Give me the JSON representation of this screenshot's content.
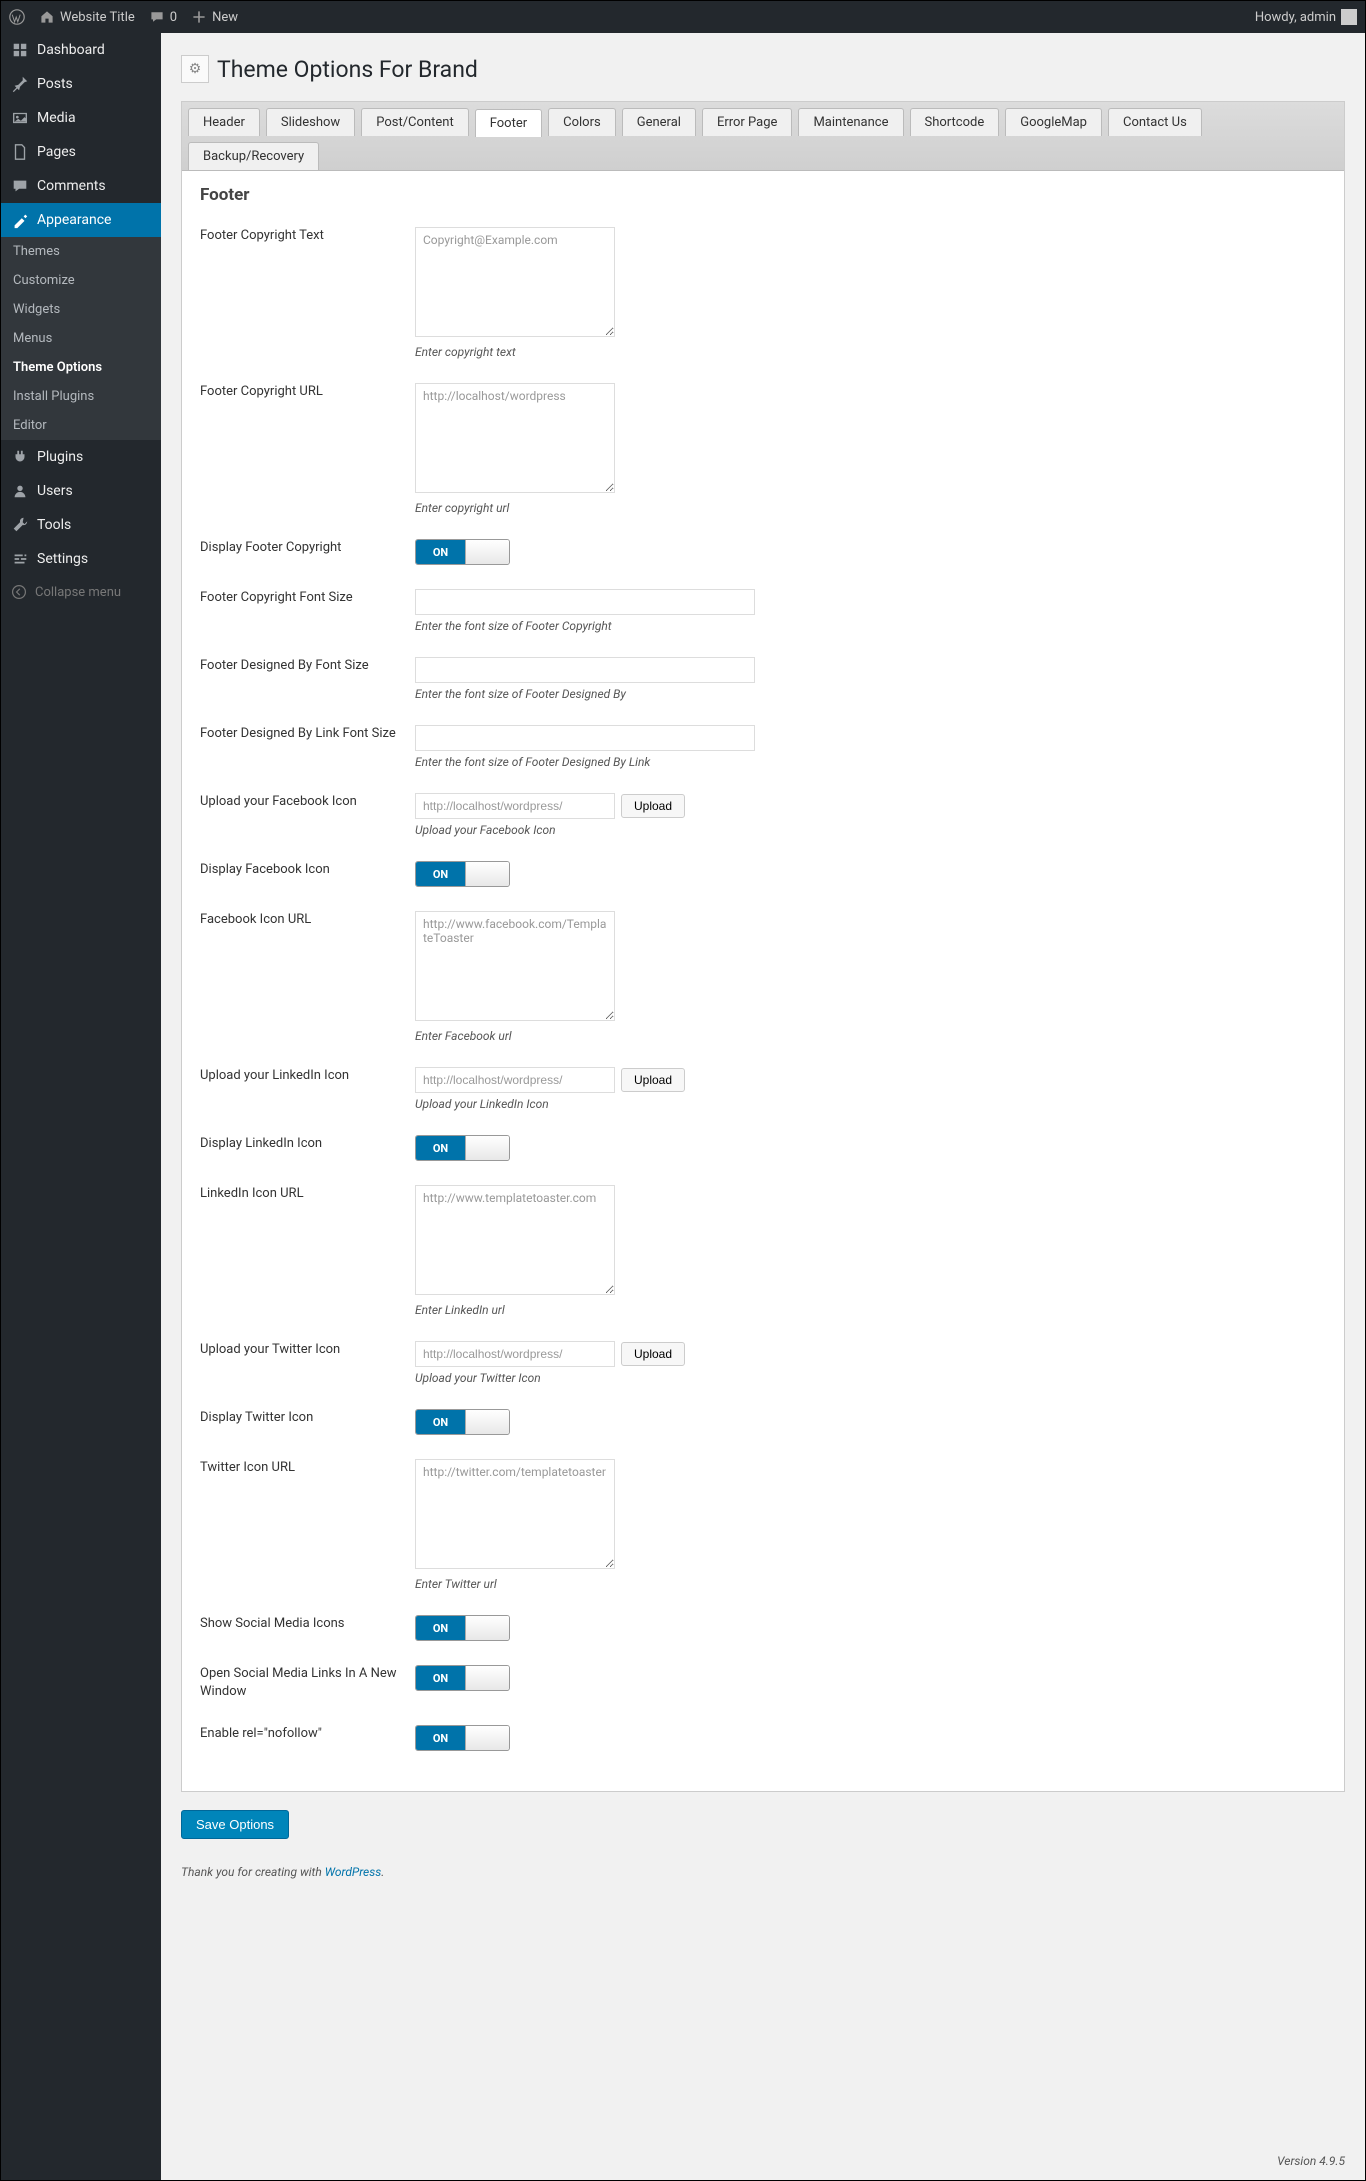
{
  "adminbar": {
    "site_title": "Website Title",
    "comment_count": "0",
    "new_label": "New",
    "howdy": "Howdy, admin"
  },
  "sidebar": {
    "items": [
      {
        "label": "Dashboard",
        "icon": "dashboard"
      },
      {
        "label": "Posts",
        "icon": "pin"
      },
      {
        "label": "Media",
        "icon": "media"
      },
      {
        "label": "Pages",
        "icon": "page"
      },
      {
        "label": "Comments",
        "icon": "comment"
      },
      {
        "label": "Appearance",
        "icon": "appearance",
        "active": true,
        "submenu": [
          {
            "label": "Themes"
          },
          {
            "label": "Customize"
          },
          {
            "label": "Widgets"
          },
          {
            "label": "Menus"
          },
          {
            "label": "Theme Options",
            "current": true
          },
          {
            "label": "Install Plugins"
          },
          {
            "label": "Editor"
          }
        ]
      },
      {
        "label": "Plugins",
        "icon": "plugin"
      },
      {
        "label": "Users",
        "icon": "user"
      },
      {
        "label": "Tools",
        "icon": "tool"
      },
      {
        "label": "Settings",
        "icon": "settings"
      }
    ],
    "collapse_label": "Collapse menu"
  },
  "page": {
    "title": "Theme Options For Brand",
    "tabs": [
      "Header",
      "Slideshow",
      "Post/Content",
      "Footer",
      "Colors",
      "General",
      "Error Page",
      "Maintenance",
      "Shortcode",
      "GoogleMap",
      "Contact Us",
      "Backup/Recovery"
    ],
    "active_tab": "Footer",
    "section_title": "Footer",
    "save_button": "Save Options",
    "footer_credit_prefix": "Thank you for creating with ",
    "footer_credit_link": "WordPress",
    "version": "Version 4.9.5"
  },
  "fields": {
    "copyright_text": {
      "label": "Footer Copyright Text",
      "placeholder": "Copyright@Example.com",
      "help": "Enter copyright text"
    },
    "copyright_url": {
      "label": "Footer Copyright URL",
      "placeholder": "http://localhost/wordpress",
      "help": "Enter copyright url"
    },
    "display_copyright": {
      "label": "Display Footer Copyright",
      "toggle": "ON"
    },
    "copyright_font": {
      "label": "Footer Copyright Font Size",
      "help": "Enter the font size of Footer Copyright"
    },
    "designed_by_font": {
      "label": "Footer Designed By Font Size",
      "help": "Enter the font size of Footer Designed By"
    },
    "designed_by_link_font": {
      "label": "Footer Designed By Link Font Size",
      "help": "Enter the font size of Footer Designed By Link"
    },
    "fb_icon_upload": {
      "label": "Upload your Facebook Icon",
      "placeholder": "http://localhost/wordpress/",
      "button": "Upload",
      "help": "Upload your Facebook Icon"
    },
    "fb_display": {
      "label": "Display Facebook Icon",
      "toggle": "ON"
    },
    "fb_url": {
      "label": "Facebook Icon URL",
      "placeholder": "http://www.facebook.com/TemplateToaster",
      "help": "Enter Facebook url"
    },
    "li_icon_upload": {
      "label": "Upload your LinkedIn Icon",
      "placeholder": "http://localhost/wordpress/",
      "button": "Upload",
      "help": "Upload your LinkedIn Icon"
    },
    "li_display": {
      "label": "Display LinkedIn Icon",
      "toggle": "ON"
    },
    "li_url": {
      "label": "LinkedIn Icon URL",
      "placeholder": "http://www.templatetoaster.com",
      "help": "Enter LinkedIn url"
    },
    "tw_icon_upload": {
      "label": "Upload your Twitter Icon",
      "placeholder": "http://localhost/wordpress/",
      "button": "Upload",
      "help": "Upload your Twitter Icon"
    },
    "tw_display": {
      "label": "Display Twitter Icon",
      "toggle": "ON"
    },
    "tw_url": {
      "label": "Twitter Icon URL",
      "placeholder": "http://twitter.com/templatetoaster",
      "help": "Enter Twitter url"
    },
    "show_social": {
      "label": "Show Social Media Icons",
      "toggle": "ON"
    },
    "open_new": {
      "label": "Open Social Media Links In A New Window",
      "toggle": "ON"
    },
    "nofollow": {
      "label": "Enable rel=\"nofollow\"",
      "toggle": "ON"
    }
  }
}
